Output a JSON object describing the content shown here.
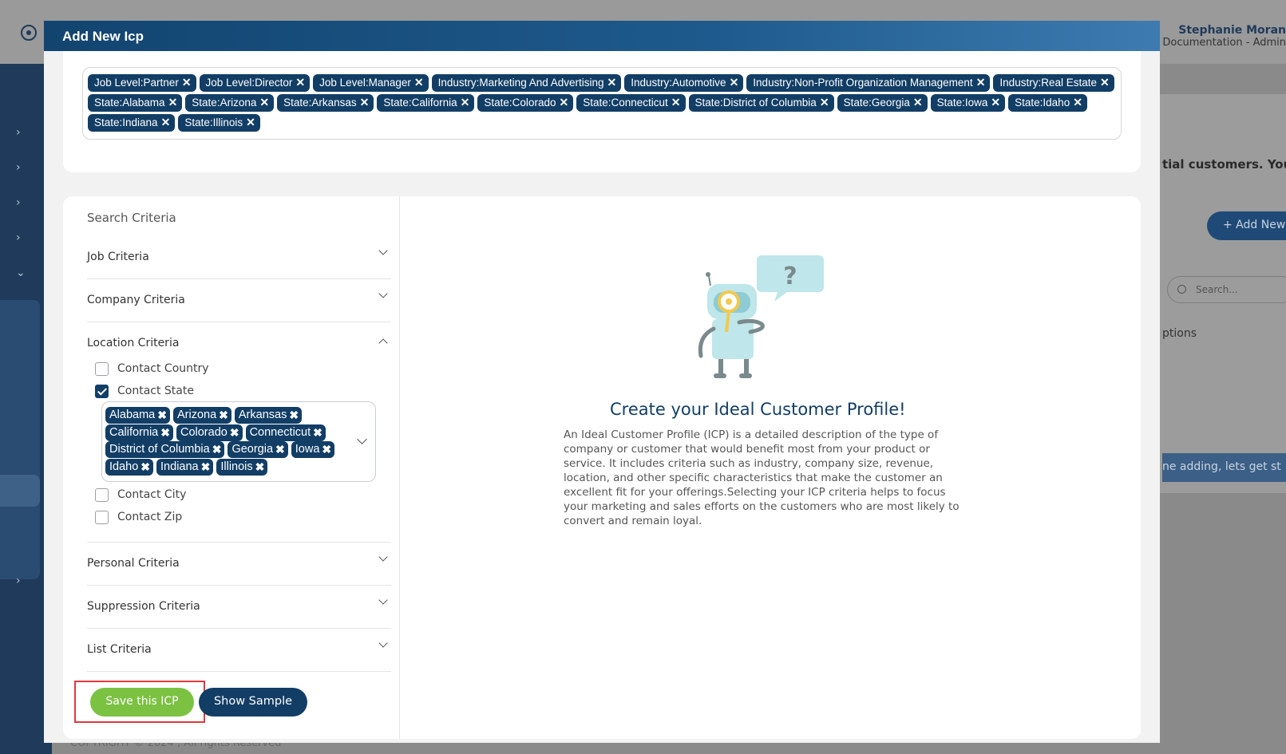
{
  "background": {
    "user_name": "Stephanie Moran",
    "user_role": "Documentation - Admin",
    "text_potential": "tial customers. You",
    "add_new_label": "+ Add New",
    "search_placeholder": "Search...",
    "options_label": "ptions",
    "banner_text": "ne adding, lets get st",
    "copyright": "COPYRIGHT © 2024 , All rights Reserved"
  },
  "modal": {
    "title": "Add New Icp",
    "selected_tags": [
      "Job Level:Partner",
      "Job Level:Director",
      "Job Level:Manager",
      "Industry:Marketing And Advertising",
      "Industry:Automotive",
      "Industry:Non-Profit Organization Management",
      "Industry:Real Estate",
      "State:Alabama",
      "State:Arizona",
      "State:Arkansas",
      "State:California",
      "State:Colorado",
      "State:Connecticut",
      "State:District of Columbia",
      "State:Georgia",
      "State:Iowa",
      "State:Idaho",
      "State:Indiana",
      "State:Illinois"
    ],
    "search_criteria_title": "Search Criteria",
    "criteria": {
      "job": "Job Criteria",
      "company": "Company Criteria",
      "location": "Location Criteria",
      "personal": "Personal Criteria",
      "suppression": "Suppression Criteria",
      "list": "List Criteria"
    },
    "location_options": {
      "country": "Contact Country",
      "state": "Contact State",
      "city": "Contact City",
      "zip": "Contact Zip"
    },
    "selected_states": [
      "Alabama",
      "Arizona",
      "Arkansas",
      "California",
      "Colorado",
      "Connecticut",
      "District of Columbia",
      "Georgia",
      "Iowa",
      "Idaho",
      "Indiana",
      "Illinois"
    ],
    "save_button": "Save this ICP",
    "sample_button": "Show Sample",
    "cta_title": "Create your Ideal Customer Profile!",
    "cta_description": "An Ideal Customer Profile (ICP) is a detailed description of the type of company or customer that would benefit most from your product or service. It includes criteria such as industry, company size, revenue, location, and other specific characteristics that make the customer an excellent fit for your offerings.Selecting your ICP criteria helps to focus your marketing and sales efforts on the customers who are most likely to convert and remain loyal.",
    "robot_bubble": "?"
  },
  "colors": {
    "primary": "#123e66",
    "save": "#7cc242",
    "highlight": "#e0393e"
  }
}
